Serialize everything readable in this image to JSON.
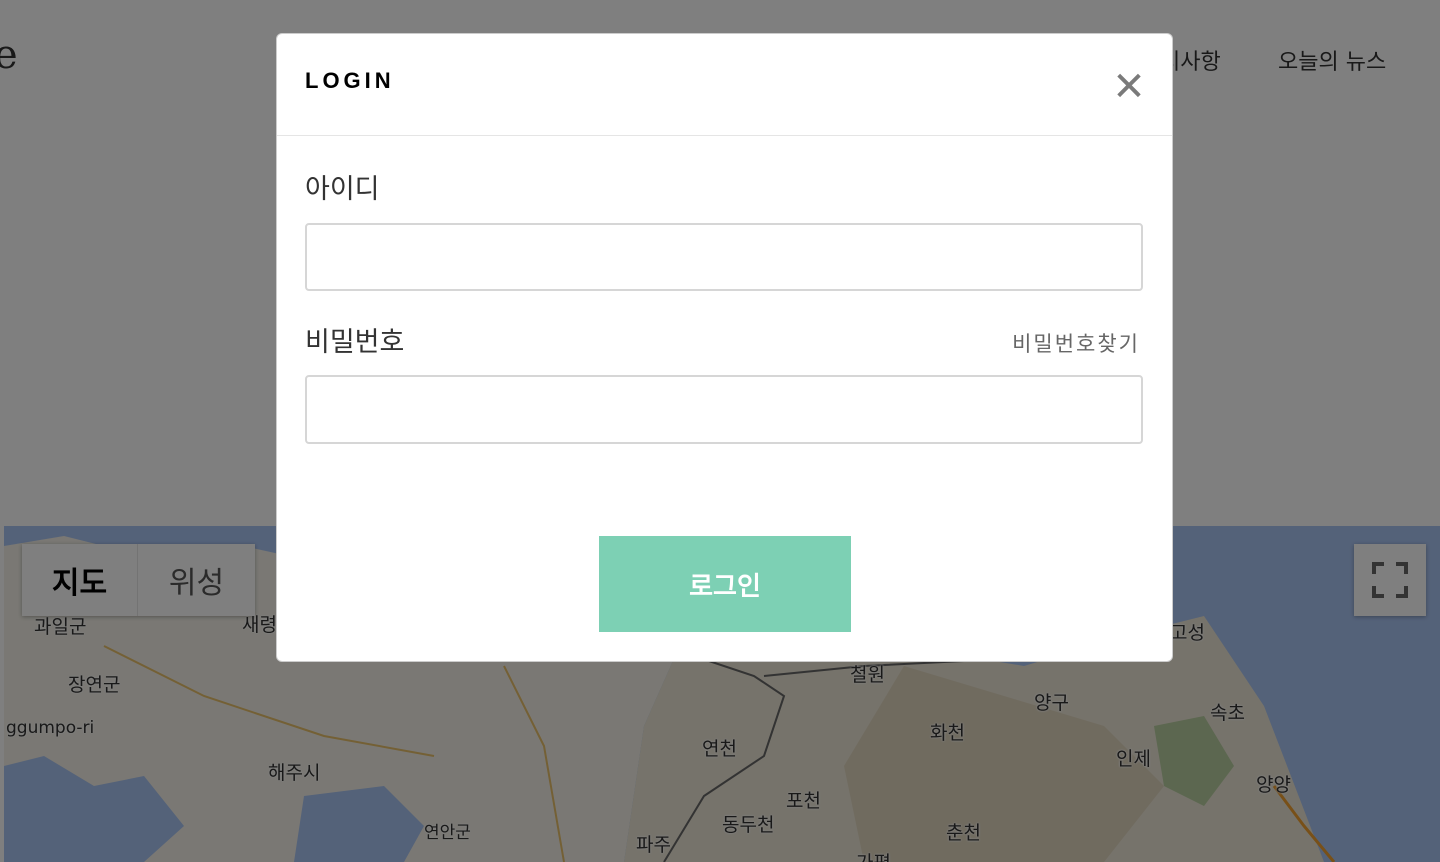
{
  "header": {
    "brand_fragment": "e",
    "nav": [
      {
        "label": "지사항"
      },
      {
        "label": "오늘의 뉴스"
      }
    ]
  },
  "map": {
    "map_types": [
      {
        "label": "지도",
        "selected": true
      },
      {
        "label": "위성",
        "selected": false
      }
    ],
    "labels": [
      "과일군",
      "새령",
      "장연군",
      "ggumpo-ri",
      "해주시",
      "연안군",
      "파주",
      "동두천",
      "포천",
      "연천",
      "철원",
      "화천",
      "양구",
      "춘천",
      "인제",
      "고성",
      "속초",
      "양양",
      "가평"
    ],
    "fullscreen_icon": "fullscreen-icon"
  },
  "modal": {
    "title": "LOGIN",
    "close_icon": "close-icon",
    "close_glyph": "✕",
    "id_label": "아이디",
    "id_value": "",
    "password_label": "비밀번호",
    "password_value": "",
    "find_password_link": "비밀번호찾기",
    "submit_label": "로그인",
    "submit_color": "#7dd0b4"
  }
}
